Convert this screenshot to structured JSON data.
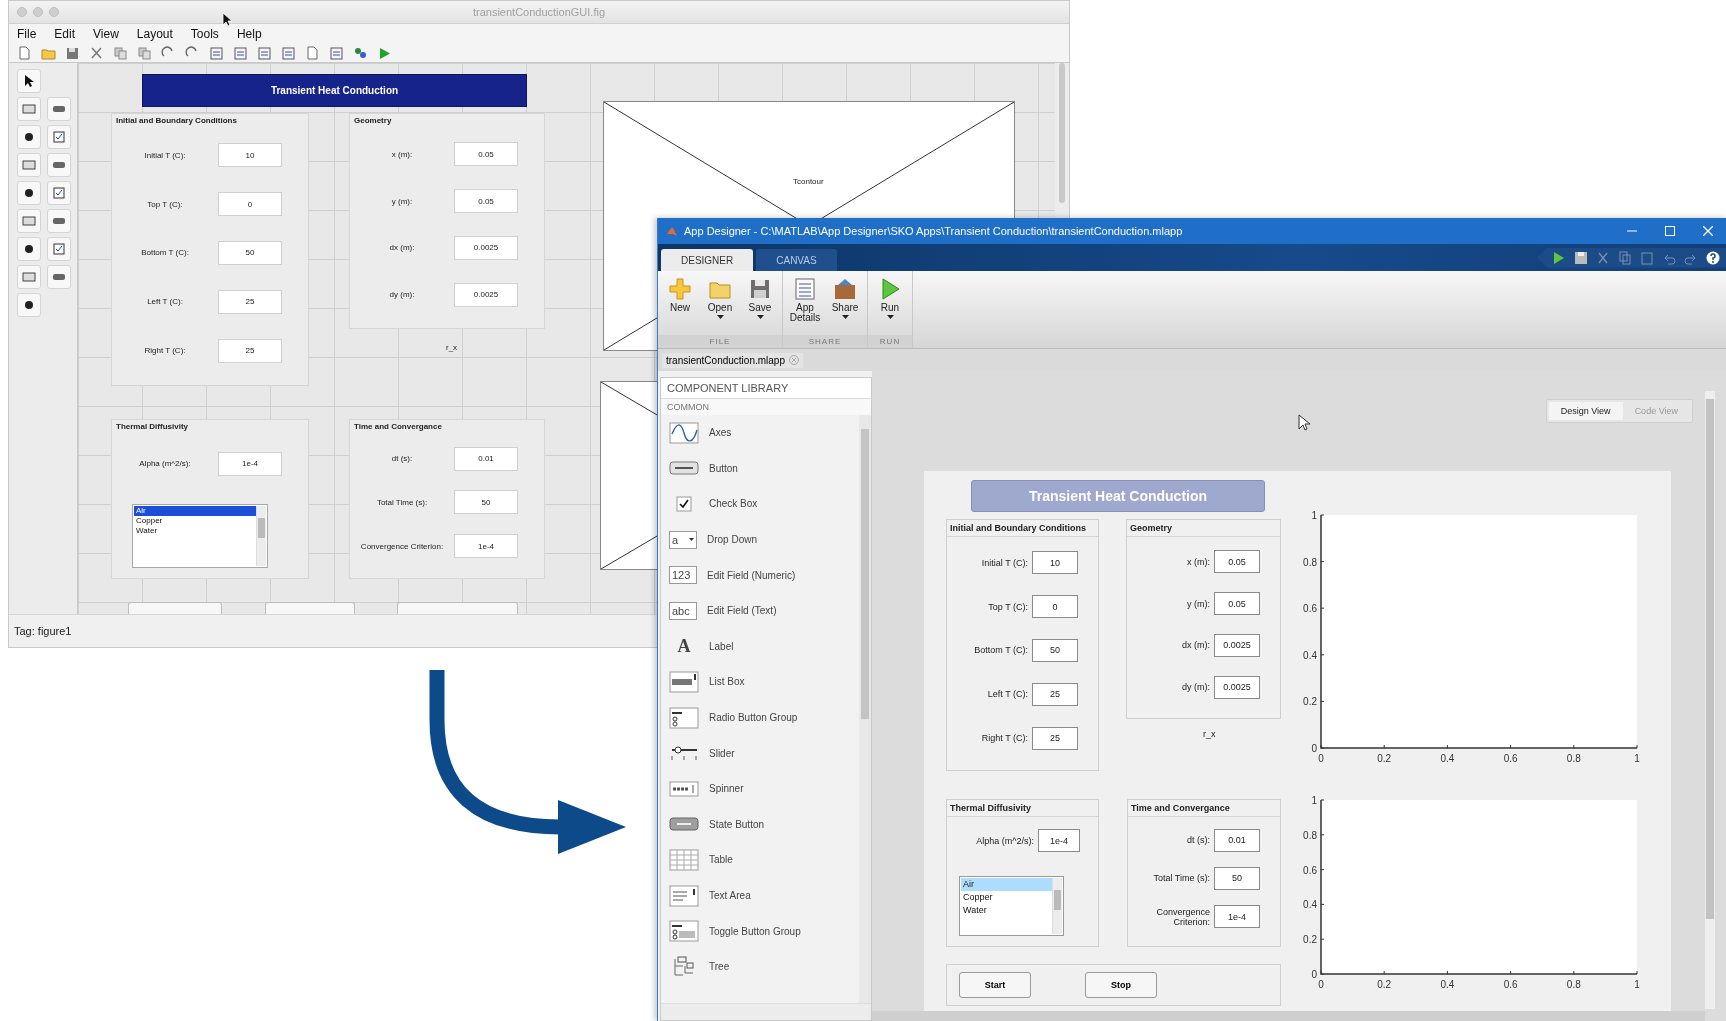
{
  "guide_window": {
    "title": "transientConductionGUI.fig",
    "menu": [
      "File",
      "Edit",
      "View",
      "Layout",
      "Tools",
      "Help"
    ],
    "heading": "Transient Heat Conduction",
    "panels": [
      {
        "title": "Initial and Boundary Conditions",
        "fields": [
          {
            "label": "Initial T (C):",
            "value": "10"
          },
          {
            "label": "Top T (C):",
            "value": "0"
          },
          {
            "label": "Bottom T (C):",
            "value": "50"
          },
          {
            "label": "Left T (C):",
            "value": "25"
          },
          {
            "label": "Right T (C):",
            "value": "25"
          }
        ]
      },
      {
        "title": "Geometry",
        "fields": [
          {
            "label": "x (m):",
            "value": "0.05"
          },
          {
            "label": "y (m):",
            "value": "0.05"
          },
          {
            "label": "dx (m):",
            "value": "0.0025"
          },
          {
            "label": "dy (m):",
            "value": "0.0025"
          }
        ]
      },
      {
        "title": "Thermal Diffusivity",
        "fields": [
          {
            "label": "Alpha (m^2/s):",
            "value": "1e-4"
          }
        ],
        "listbox": [
          {
            "label": "Air",
            "selected": true
          },
          {
            "label": "Copper",
            "selected": false
          },
          {
            "label": "Water",
            "selected": false
          }
        ]
      },
      {
        "title": "Time and Convergance",
        "fields": [
          {
            "label": "dt (s):",
            "value": "0.01"
          },
          {
            "label": "Total Time (s):",
            "value": "50"
          },
          {
            "label": "Convergence Criterion:",
            "value": "1e-4"
          }
        ]
      }
    ],
    "static_text": "r_x",
    "axes_label": "Tcontour",
    "status_bar": "Tag: figure1"
  },
  "app_designer": {
    "title": "App Designer - C:\\MATLAB\\App Designer\\SKO Apps\\Transient Conduction\\transientConduction.mlapp",
    "tabs": [
      {
        "label": "DESIGNER",
        "selected": true
      },
      {
        "label": "CANVAS",
        "selected": false
      }
    ],
    "toolstrip": [
      {
        "group": "FILE",
        "buttons": [
          {
            "label": "New",
            "kind": "new",
            "dropdown": false
          },
          {
            "label": "Open",
            "kind": "open",
            "dropdown": true
          },
          {
            "label": "Save",
            "kind": "save",
            "dropdown": true
          }
        ]
      },
      {
        "group": "SHARE",
        "buttons": [
          {
            "label": "App Details",
            "kind": "details",
            "dropdown": false
          },
          {
            "label": "Share",
            "kind": "share",
            "dropdown": true
          }
        ]
      },
      {
        "group": "RUN",
        "buttons": [
          {
            "label": "Run",
            "kind": "run",
            "dropdown": true
          }
        ]
      }
    ],
    "document_tab": "transientConduction.mlapp",
    "library": {
      "title": "COMPONENT LIBRARY",
      "section": "COMMON",
      "items": [
        {
          "label": "Axes",
          "kind": "axes"
        },
        {
          "label": "Button",
          "kind": "button"
        },
        {
          "label": "Check Box",
          "kind": "checkbox"
        },
        {
          "label": "Drop Down",
          "kind": "dropdown",
          "glyph": "a"
        },
        {
          "label": "Edit Field (Numeric)",
          "kind": "field",
          "glyph": "123"
        },
        {
          "label": "Edit Field (Text)",
          "kind": "field",
          "glyph": "abc"
        },
        {
          "label": "Label",
          "kind": "label",
          "glyph": "A"
        },
        {
          "label": "List Box",
          "kind": "listbox"
        },
        {
          "label": "Radio Button Group",
          "kind": "radiogroup"
        },
        {
          "label": "Slider",
          "kind": "slider"
        },
        {
          "label": "Spinner",
          "kind": "spinner"
        },
        {
          "label": "State Button",
          "kind": "statebutton"
        },
        {
          "label": "Table",
          "kind": "table"
        },
        {
          "label": "Text Area",
          "kind": "textarea"
        },
        {
          "label": "Toggle Button Group",
          "kind": "togglegroup"
        },
        {
          "label": "Tree",
          "kind": "tree"
        }
      ]
    },
    "views": [
      {
        "label": "Design View",
        "selected": true
      },
      {
        "label": "Code View",
        "selected": false
      }
    ],
    "app": {
      "heading": "Transient Heat Conduction",
      "panels": [
        {
          "title": "Initial and Boundary Conditions",
          "fields": [
            {
              "label": "Initial T (C):",
              "value": "10"
            },
            {
              "label": "Top T (C):",
              "value": "0"
            },
            {
              "label": "Bottom T (C):",
              "value": "50"
            },
            {
              "label": "Left T (C):",
              "value": "25"
            },
            {
              "label": "Right T (C):",
              "value": "25"
            }
          ]
        },
        {
          "title": "Geometry",
          "fields": [
            {
              "label": "x (m):",
              "value": "0.05"
            },
            {
              "label": "y (m):",
              "value": "0.05"
            },
            {
              "label": "dx (m):",
              "value": "0.0025"
            },
            {
              "label": "dy (m):",
              "value": "0.0025"
            }
          ]
        },
        {
          "title": "Thermal Diffusivity",
          "fields": [
            {
              "label": "Alpha (m^2/s):",
              "value": "1e-4"
            }
          ],
          "listbox": [
            {
              "label": "Air",
              "selected": true
            },
            {
              "label": "Copper",
              "selected": false
            },
            {
              "label": "Water",
              "selected": false
            }
          ]
        },
        {
          "title": "Time and Convergance",
          "fields": [
            {
              "label": "dt (s):",
              "value": "0.01"
            },
            {
              "label": "Total Time (s):",
              "value": "50"
            },
            {
              "label": "Convergence Criterion:",
              "value": "1e-4"
            }
          ]
        }
      ],
      "static_text": "r_x",
      "buttons": [
        "Start",
        "Stop"
      ],
      "charts": [
        {
          "chart_data": {
            "type": "line",
            "xlim": [
              0,
              1
            ],
            "ylim": [
              0,
              1
            ],
            "xticks": [
              0,
              0.2,
              0.4,
              0.6,
              0.8,
              1
            ],
            "yticks": [
              0,
              0.2,
              0.4,
              0.6,
              0.8,
              1
            ]
          }
        },
        {
          "chart_data": {
            "type": "line",
            "xlim": [
              0,
              1
            ],
            "ylim": [
              0,
              1
            ],
            "xticks": [
              0,
              0.2,
              0.4,
              0.6,
              0.8,
              1
            ],
            "yticks": [
              0,
              0.2,
              0.4,
              0.6,
              0.8,
              1
            ]
          }
        }
      ]
    }
  }
}
